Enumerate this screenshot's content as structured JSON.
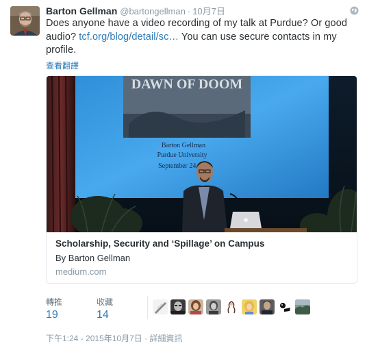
{
  "author": {
    "name": "Barton Gellman",
    "handle": "@bartongellman",
    "separator": "·",
    "date": "10月7日"
  },
  "tweet": {
    "text_before": "Does anyone have a video recording of my talk at Purdue? Or good audio? ",
    "link": "tcf.org/blog/detail/sc…",
    "text_after": " You can use secure contacts in my profile.",
    "translate_label": "查看翻譯"
  },
  "card": {
    "slide_text": {
      "title": "DAWN OF DOOM",
      "line1": "Barton Gellman",
      "line2": "Purdue University",
      "line3": "September 24,"
    },
    "title": "Scholarship, Security and ‘Spillage’ on Campus",
    "byline": "By Barton Gellman",
    "domain": "medium.com"
  },
  "stats": {
    "retweets_label": "轉推",
    "retweets_count": "19",
    "favorites_label": "收藏",
    "favorites_count": "14"
  },
  "favoriter_avatars": [
    "pen-avatar",
    "bw-face-avatar",
    "woman-avatar",
    "bw-woman-avatar",
    "drawing-avatar",
    "blonde-avatar",
    "man-avatar",
    "cartoon-avatar",
    "landscape-avatar"
  ],
  "footer": {
    "timestamp": "下午1:24 - 2015年10月7日",
    "separator": " · ",
    "details_link": "詳細資訊"
  },
  "colors": {
    "link": "#2b7bb9",
    "text": "#292f33",
    "muted": "#8899a6",
    "border": "#e1e8ed"
  }
}
